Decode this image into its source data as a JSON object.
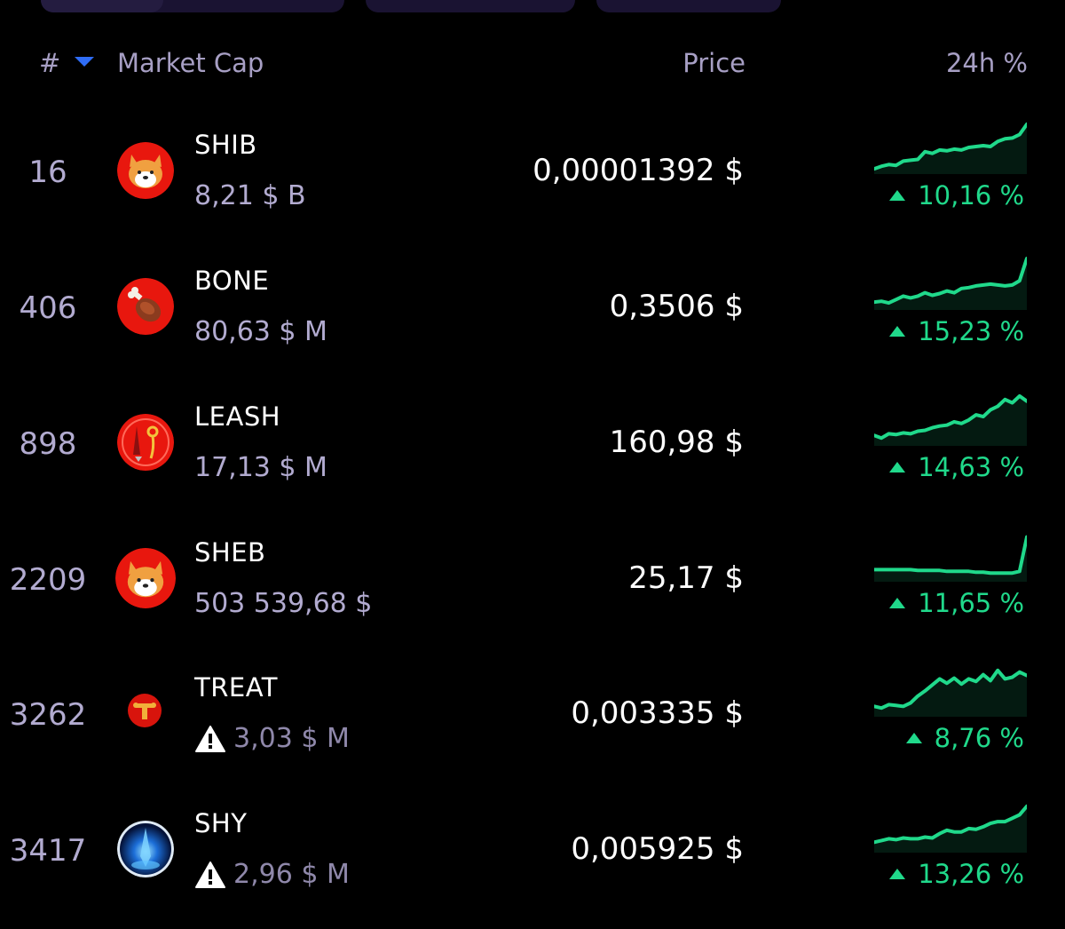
{
  "colors": {
    "background": "#000000",
    "header_text": "#a79fc4",
    "secondary_text": "#b2abd0",
    "positive": "#20d98b",
    "sort_arrow": "#2f6df6",
    "top_tab_bg": "#1a1332"
  },
  "header": {
    "rank_label": "#",
    "sort_icon": "sort-desc-triangle-icon",
    "market_cap_label": "Market Cap",
    "price_label": "Price",
    "change_label": "24h %"
  },
  "rows": [
    {
      "rank": "16",
      "name": "SHIB",
      "market_cap": "8,21 $ B",
      "warning": false,
      "price": "0,00001392 $",
      "change": "10,16 %",
      "logo": "shiba-dog-icon",
      "sparkline": [
        2,
        5,
        7,
        6,
        11,
        12,
        13,
        22,
        20,
        24,
        23,
        25,
        24,
        27,
        28,
        29,
        28,
        34,
        37,
        38,
        42,
        54
      ]
    },
    {
      "rank": "406",
      "name": "BONE",
      "market_cap": "80,63 $ M",
      "warning": false,
      "price": "0,3506 $",
      "change": "15,23 %",
      "logo": "bone-meat-icon",
      "sparkline": [
        5,
        6,
        4,
        8,
        12,
        10,
        12,
        16,
        13,
        15,
        18,
        16,
        21,
        22,
        24,
        25,
        26,
        25,
        24,
        25,
        30,
        56
      ]
    },
    {
      "rank": "898",
      "name": "LEASH",
      "market_cap": "17,13 $ M",
      "warning": false,
      "price": "160,98 $",
      "change": "14,63 %",
      "logo": "leash-icon",
      "sparkline": [
        8,
        5,
        10,
        9,
        11,
        10,
        13,
        14,
        17,
        19,
        20,
        24,
        22,
        26,
        32,
        30,
        38,
        42,
        50,
        46,
        54,
        48
      ]
    },
    {
      "rank": "2209",
      "name": "SHEB",
      "market_cap": "503 539,68 $",
      "warning": false,
      "price": "25,17 $",
      "change": "11,65 %",
      "logo": "shiba-dog-icon",
      "sparkline": [
        10,
        10,
        10,
        10,
        10,
        10,
        9,
        9,
        9,
        9,
        8,
        8,
        8,
        8,
        7,
        7,
        6,
        6,
        6,
        6,
        8,
        48
      ]
    },
    {
      "rank": "3262",
      "name": "TREAT",
      "market_cap": "3,03 $ M",
      "warning": true,
      "price": "0,003335 $",
      "change": "8,76 %",
      "logo": "treat-icon",
      "sparkline": [
        8,
        6,
        10,
        9,
        8,
        12,
        20,
        26,
        33,
        40,
        35,
        41,
        34,
        40,
        37,
        45,
        38,
        50,
        40,
        42,
        48,
        44
      ]
    },
    {
      "rank": "3417",
      "name": "SHY",
      "market_cap": "2,96 $ M",
      "warning": true,
      "price": "0,005925 $",
      "change": "13,26 %",
      "logo": "shy-crystal-icon",
      "sparkline": [
        8,
        10,
        12,
        11,
        13,
        12,
        12,
        14,
        13,
        18,
        22,
        20,
        20,
        24,
        23,
        26,
        30,
        32,
        32,
        36,
        40,
        50
      ]
    }
  ]
}
